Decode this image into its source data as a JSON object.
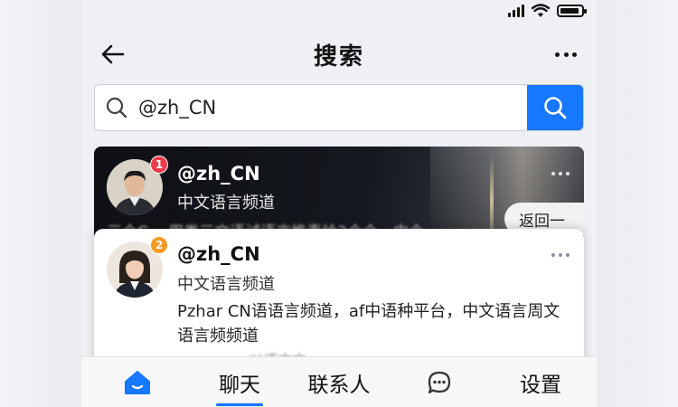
{
  "header": {
    "title": "搜索"
  },
  "search": {
    "value": "@zh_CN"
  },
  "results": [
    {
      "badge": "1",
      "name": "@zh_CN",
      "subtitle": "中文语言频道",
      "snippet": "三个C…  用类三文语试语言推责给2个个，中个",
      "action_label": "返回一"
    },
    {
      "badge": "2",
      "name": "@zh_CN",
      "subtitle": "中文语言频道",
      "description": "Pzhar  CN语语言频道，af中语种平台，中文语言周文语言频频道",
      "snippet": "… …  …… 以语言文 …"
    }
  ],
  "tabbar": {
    "chat": "聊天",
    "contacts": "联系人",
    "settings": "设置"
  },
  "colors": {
    "accent": "#1677ff",
    "badge_red": "#ee3b4d",
    "badge_orange": "#f59a23"
  },
  "status": {
    "battery_percent": 90
  }
}
